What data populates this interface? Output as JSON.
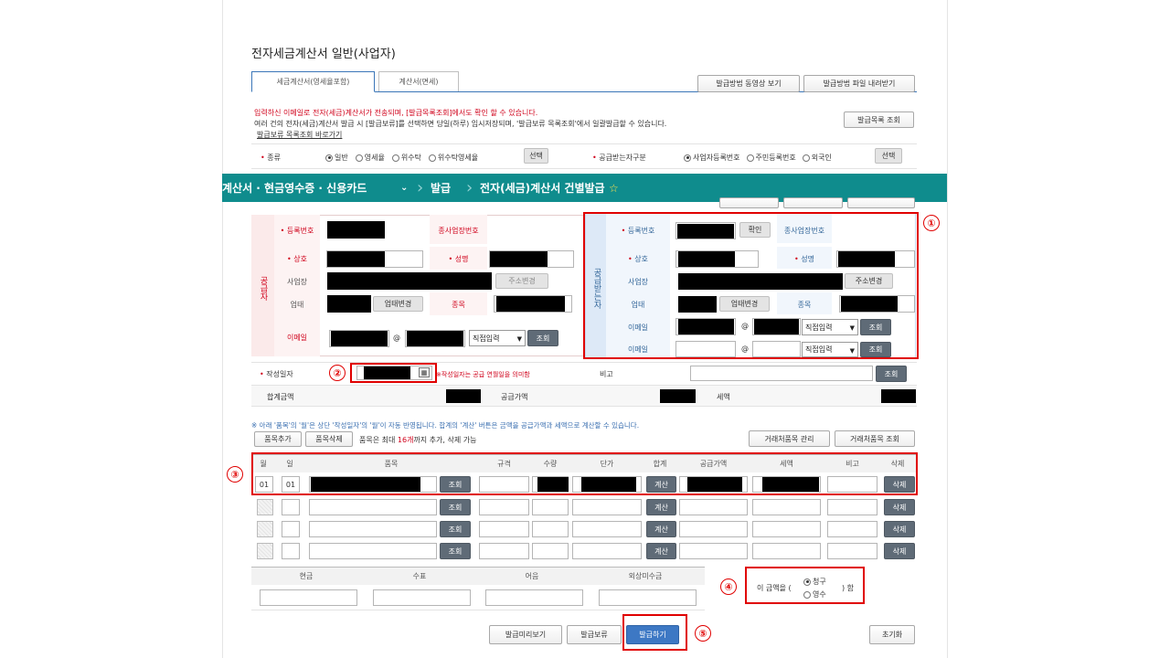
{
  "page_title": "전자세금계산서 일반(사업자)",
  "tabs": [
    "세금계산서(영세율포함)",
    "계산서(면세)"
  ],
  "top_buttons": {
    "video": "발급방법 동영상 보기",
    "download": "발급방법 파일 내려받기",
    "catalog": "발급목록 조회"
  },
  "notice": {
    "line1": "입력하신 이메일로 전자(세금)계산서가 전송되며, [발급목록조회]에서도 확인 할 수 있습니다.",
    "line2": "여러 건의 전자(세금)계산서 발급 시 [발급보류]를 선택하면 당일(하루) 임시저장되며, '발급보류 목록조회'에서 일괄발급할 수 있습니다.",
    "link": "발급보류 목록조회 바로가기"
  },
  "type_row": {
    "label": "종류",
    "options": [
      "일반",
      "영세율",
      "위수탁",
      "위수탁영세율"
    ],
    "select_btn": "선택",
    "buyer_label": "공급받는자구분",
    "buyer_options": [
      "사업자등록번호",
      "주민등록번호",
      "외국인"
    ],
    "buyer_select_btn": "선택"
  },
  "nav": {
    "section": "계산서 · 현금영수증 · 신용카드",
    "item1": "발급",
    "item2": "전자(세금)계산서 건별발급",
    "star": "☆"
  },
  "supplier": {
    "side": "공급자",
    "reg_no": "등록번호",
    "sub_biz": "종사업장번호",
    "name": "상호",
    "ceo": "성명",
    "address": "사업장",
    "addr_btn": "주소변경",
    "biz_type": "업태",
    "type_btn": "업태변경",
    "item": "종목",
    "email": "이메일",
    "at": "@",
    "direct": "직접입력",
    "lookup": "조회"
  },
  "buyer": {
    "side": "공급받는자",
    "reg_no": "등록번호",
    "confirm": "확인",
    "sub_biz": "종사업장번호",
    "name": "상호",
    "ceo": "성명",
    "address": "사업장",
    "addr_btn": "주소변경",
    "biz_type": "업태",
    "type_btn": "업태변경",
    "item": "종목",
    "email1": "이메일",
    "email2": "이메일",
    "at": "@",
    "direct": "직접입력",
    "lookup": "조회"
  },
  "date_row": {
    "label": "작성일자",
    "note": "※작성일자는 공급 연월일을 의미함",
    "remark": "비고",
    "lookup": "조회"
  },
  "totals": {
    "total": "합계금액",
    "supply": "공급가액",
    "tax": "세액"
  },
  "items_note": "※ 아래 '품목'의 '월'은 상단 '작성일자'의 '월'이 자동 반영됩니다. 합계의 '계산' 버튼은 금액을 공급가액과 세액으로 계산할 수 있습니다.",
  "items_controls": {
    "add": "품목추가",
    "del": "품목삭제",
    "info_pre": "품목은 최대",
    "max": "16개",
    "info_post": "까지 추가, 삭제 가능",
    "partner_manage": "거래처품목 관리",
    "partner_lookup": "거래처품목 조회"
  },
  "items_header": [
    "월",
    "일",
    "품목",
    "규격",
    "수량",
    "단가",
    "합계",
    "공급가액",
    "세액",
    "비고",
    "삭제"
  ],
  "first_row": {
    "month": "01",
    "day": "01"
  },
  "row_buttons": {
    "lookup": "조회",
    "calc": "계산",
    "delete": "삭제"
  },
  "payment": {
    "cash": "현금",
    "check": "수표",
    "note": "어음",
    "credit": "외상미수금"
  },
  "claim": {
    "pre": "이 금액을 (",
    "opt1": "청구",
    "opt2": "영수",
    "post": ") 함"
  },
  "bottom_buttons": {
    "preview": "발급미리보기",
    "hold": "발급보류",
    "issue": "발급하기",
    "reset": "초기화"
  },
  "markers": [
    "①",
    "②",
    "③",
    "④",
    "⑤"
  ]
}
